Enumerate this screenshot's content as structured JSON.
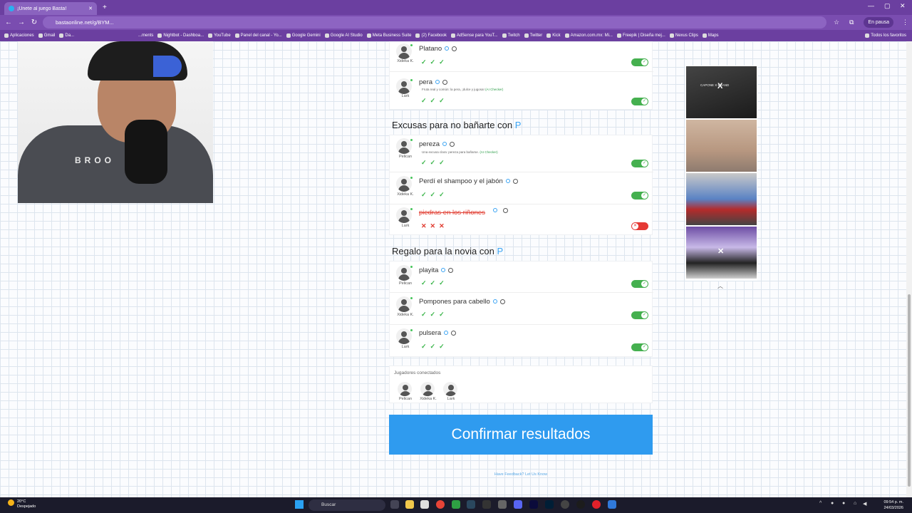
{
  "browser": {
    "tab_title": "¡Únete al juego Basta!",
    "url": "bastaonline.net/g/BYM...",
    "pause_label": "En pausa",
    "bookmarks": [
      "Aplicaciones",
      "Gmail",
      "Da...",
      "...ments",
      "Nightbot - Dashboa...",
      "YouTube",
      "Panel del canal - Yo...",
      "Google Gemini",
      "Google AI Studio",
      "Meta Business Suite",
      "(2) Facebook",
      "AdSense para YouT...",
      "Twitch",
      "Twitter",
      "Kick",
      "Amazon.com.mx: Mi...",
      "Freepik | Diseña mej...",
      "Nexus Clips",
      "Maps"
    ],
    "all_favorites": "Todos los favoritos"
  },
  "webcam": {
    "shirt_text": "BROO"
  },
  "game": {
    "sections": [
      {
        "category": "",
        "letter": "",
        "answers": [
          {
            "player": "Xideka K.",
            "word": "Platano",
            "definition": "",
            "ai_tag": "",
            "valid": true
          },
          {
            "player": "Lark",
            "word": "pera",
            "definition": "Fruta real y común: la pera, ¡dulce y jugosa!",
            "ai_tag": "(AI Checker)",
            "valid": true
          }
        ]
      },
      {
        "category": "Excusas para no bañarte con",
        "letter": "P",
        "answers": [
          {
            "player": "Pelican",
            "word": "pereza",
            "definition": "Una excusa clara: pereza para bañarse.",
            "ai_tag": "(AI Checker)",
            "valid": true
          },
          {
            "player": "Xideka K.",
            "word": "Perdí el shampoo y el jabón",
            "definition": "",
            "ai_tag": "",
            "valid": true
          },
          {
            "player": "Lark",
            "word": "piedras en los riñones",
            "definition": "",
            "ai_tag": "",
            "valid": false
          }
        ]
      },
      {
        "category": "Regalo para la novia con",
        "letter": "P",
        "answers": [
          {
            "player": "Pelican",
            "word": "playita",
            "definition": "",
            "ai_tag": "",
            "valid": true
          },
          {
            "player": "Xideka K.",
            "word": "Pompones para cabello",
            "definition": "",
            "ai_tag": "",
            "valid": true
          },
          {
            "player": "Lark",
            "word": "pulsera",
            "definition": "",
            "ai_tag": "",
            "valid": true
          }
        ]
      }
    ],
    "players_title": "Jugadores conectados",
    "players": [
      "Pelican",
      "Xideka K.",
      "Lark"
    ],
    "confirm_label": "Confirmar resultados",
    "feedback_label": "Have Feedback? Let Us Know"
  },
  "ads": {
    "brand": "X",
    "desc_1": "CAPONE X BRAND"
  },
  "taskbar": {
    "temp": "20°C",
    "weather": "Despejado",
    "search_placeholder": "Buscar",
    "time": "09:54 p. m.",
    "date": "24/03/2026"
  },
  "colors": {
    "accent": "#2f9bef",
    "valid": "#45b04f",
    "invalid": "#e53935",
    "chrome": "#6b3fa0"
  }
}
